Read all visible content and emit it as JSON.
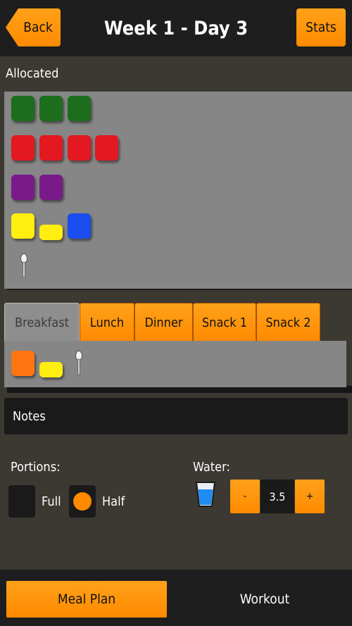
{
  "header": {
    "back_label": "Back",
    "title": "Week 1 - Day 3",
    "stats_label": "Stats"
  },
  "allocated": {
    "label": "Allocated",
    "rows": [
      {
        "color": "green",
        "count": 3
      },
      {
        "color": "red",
        "count": 4
      },
      {
        "color": "purple",
        "count": 2
      },
      {
        "items": [
          "yellow",
          "yellow-half",
          "blue"
        ]
      },
      {
        "items": [
          "spoon"
        ]
      }
    ]
  },
  "tabs": [
    {
      "label": "Breakfast",
      "active": true
    },
    {
      "label": "Lunch",
      "active": false
    },
    {
      "label": "Dinner",
      "active": false
    },
    {
      "label": "Snack 1",
      "active": false
    },
    {
      "label": "Snack 2",
      "active": false
    }
  ],
  "meal_items": [
    "orange",
    "yellow-half",
    "spoon"
  ],
  "notes_label": "Notes",
  "portions": {
    "label": "Portions:",
    "full_label": "Full",
    "half_label": "Half",
    "selected": "Half"
  },
  "water": {
    "label": "Water:",
    "icon": "water-glass-icon",
    "minus_label": "-",
    "value": "3.5",
    "plus_label": "+"
  },
  "footer": {
    "meal_plan_label": "Meal Plan",
    "workout_label": "Workout",
    "active": "Meal Plan"
  },
  "colors": {
    "accent": "#ff8a00",
    "green": "#1c6e1c",
    "red": "#e41820",
    "purple": "#7a1a8a",
    "yellow": "#ffee10",
    "blue": "#1a4cf0",
    "orange": "#ff7510"
  }
}
